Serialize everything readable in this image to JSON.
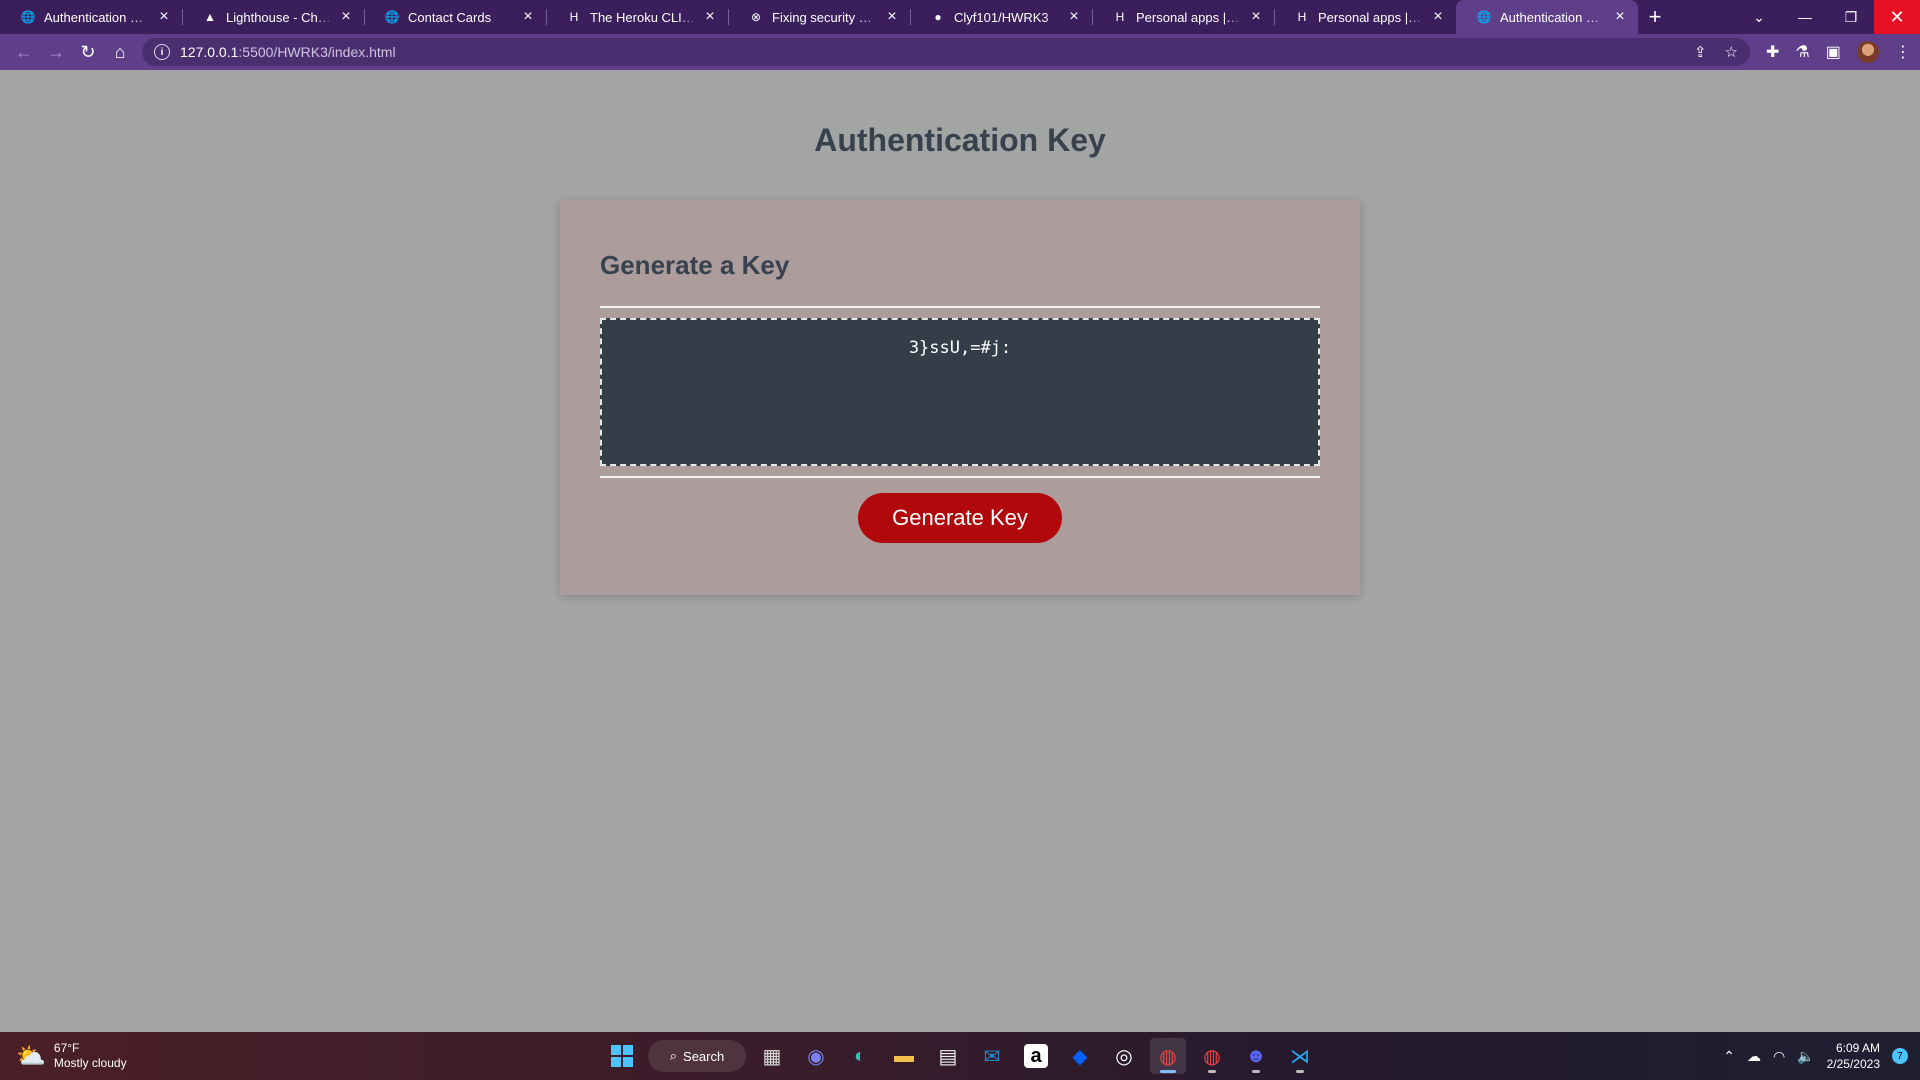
{
  "browser": {
    "tabs": [
      {
        "title": "Authentication Key",
        "favicon": "globe-icon"
      },
      {
        "title": "Lighthouse - Chrome Developers",
        "favicon": "lighthouse-icon"
      },
      {
        "title": "Contact Cards",
        "favicon": "globe-icon"
      },
      {
        "title": "The Heroku CLI | Heroku",
        "favicon": "heroku-icon"
      },
      {
        "title": "Fixing security vulnerabilities",
        "favicon": "x-circle-icon"
      },
      {
        "title": "Clyf101/HWRK3",
        "favicon": "github-icon"
      },
      {
        "title": "Personal apps | Heroku",
        "favicon": "heroku-icon"
      },
      {
        "title": "Personal apps | Heroku",
        "favicon": "heroku-icon"
      },
      {
        "title": "Authentication Key",
        "favicon": "globe-icon",
        "active": true
      }
    ],
    "url_host": "127.0.0.1",
    "url_path": ":5500/HWRK3/index.html"
  },
  "page": {
    "title": "Authentication Key",
    "card_heading": "Generate a Key",
    "generated_key": "3}ssU,=#j:",
    "button_label": "Generate Key"
  },
  "taskbar": {
    "weather_temp": "67°F",
    "weather_desc": "Mostly cloudy",
    "search_label": "Search",
    "time": "6:09 AM",
    "date": "2/25/2023",
    "notification_count": "7"
  },
  "colors": {
    "background": "#a3a5a4",
    "card": "#ad9c9c",
    "key_box": "#333e48",
    "button": "#b1080b",
    "heading": "#37424e",
    "browser_frame": "#3b1f5c"
  }
}
